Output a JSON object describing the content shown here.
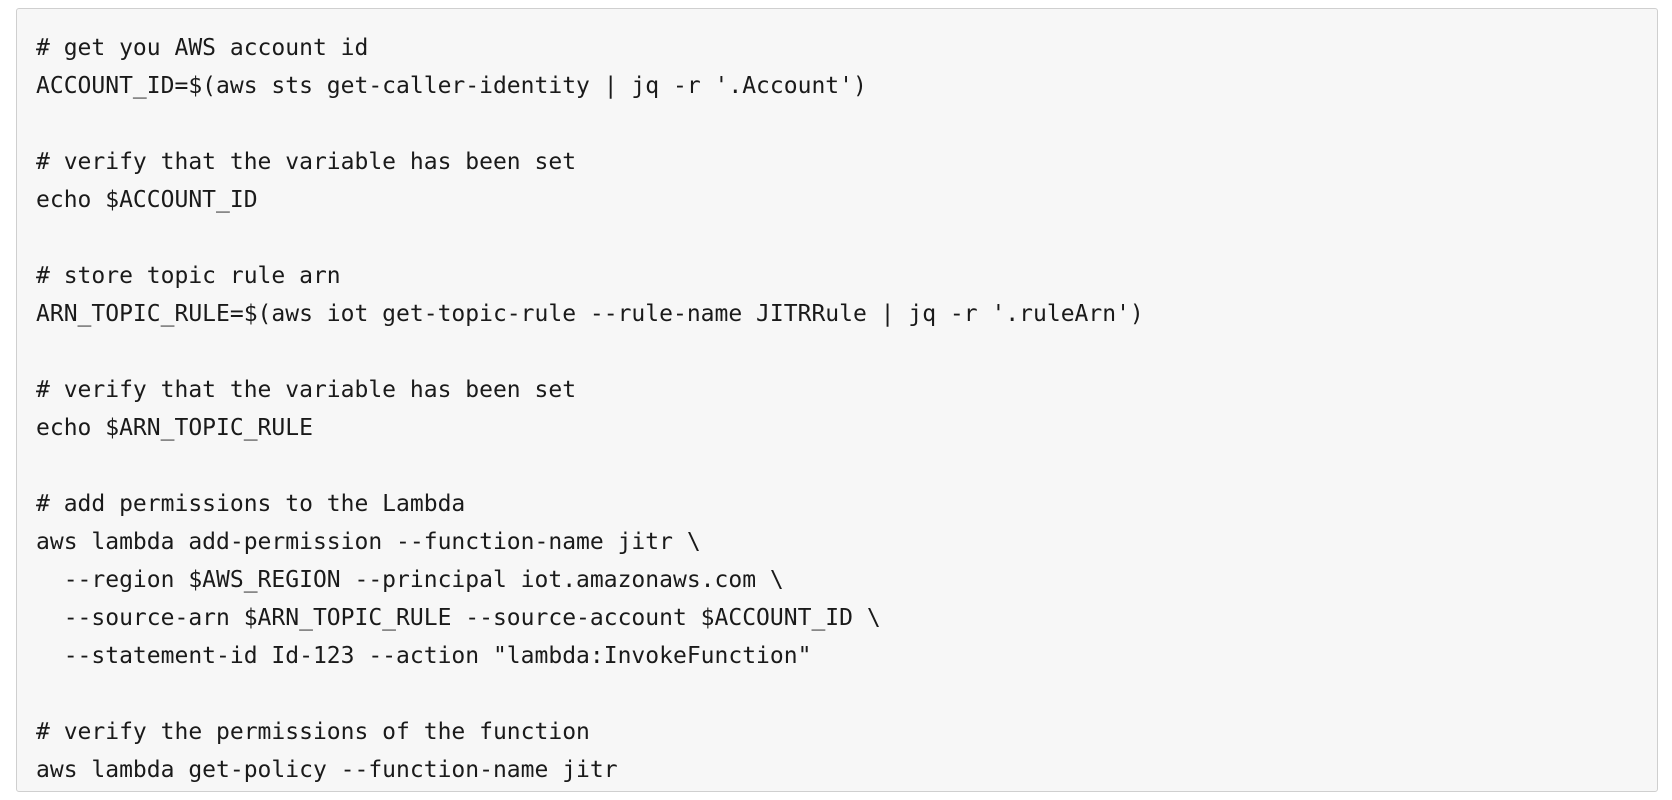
{
  "code_block": {
    "lines": [
      "# get you AWS account id",
      "ACCOUNT_ID=$(aws sts get-caller-identity | jq -r '.Account')",
      "",
      "# verify that the variable has been set",
      "echo $ACCOUNT_ID",
      "",
      "# store topic rule arn",
      "ARN_TOPIC_RULE=$(aws iot get-topic-rule --rule-name JITRRule | jq -r '.ruleArn')",
      "",
      "# verify that the variable has been set",
      "echo $ARN_TOPIC_RULE",
      "",
      "# add permissions to the Lambda",
      "aws lambda add-permission --function-name jitr \\",
      "  --region $AWS_REGION --principal iot.amazonaws.com \\",
      "  --source-arn $ARN_TOPIC_RULE --source-account $ACCOUNT_ID \\",
      "  --statement-id Id-123 --action \"lambda:InvokeFunction\"",
      "",
      "# verify the permissions of the function",
      "aws lambda get-policy --function-name jitr"
    ]
  }
}
